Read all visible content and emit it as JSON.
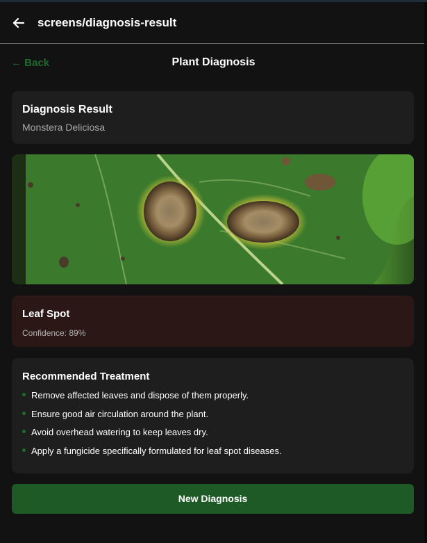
{
  "app": {
    "route_title": "screens/diagnosis-result"
  },
  "nav": {
    "back_label": "← Back",
    "screen_title": "Plant Diagnosis"
  },
  "result": {
    "title": "Diagnosis Result",
    "plant_name": "Monstera Deliciosa"
  },
  "image": {
    "alt": "leaf with brown leaf spot lesions"
  },
  "disease": {
    "name": "Leaf Spot",
    "confidence_label": "Confidence: 89%",
    "confidence_value": 89
  },
  "treatment": {
    "title": "Recommended Treatment",
    "items": [
      "Remove affected leaves and dispose of them properly.",
      "Ensure good air circulation around the plant.",
      "Avoid overhead watering to keep leaves dry.",
      "Apply a fungicide specifically formulated for leaf spot diseases."
    ]
  },
  "actions": {
    "new_diagnosis_label": "New Diagnosis"
  },
  "colors": {
    "accent": "#1e6b2c",
    "button": "#1e5a25",
    "background": "#121212",
    "card": "#1e1e1e",
    "disease_card": "#2a1716"
  }
}
